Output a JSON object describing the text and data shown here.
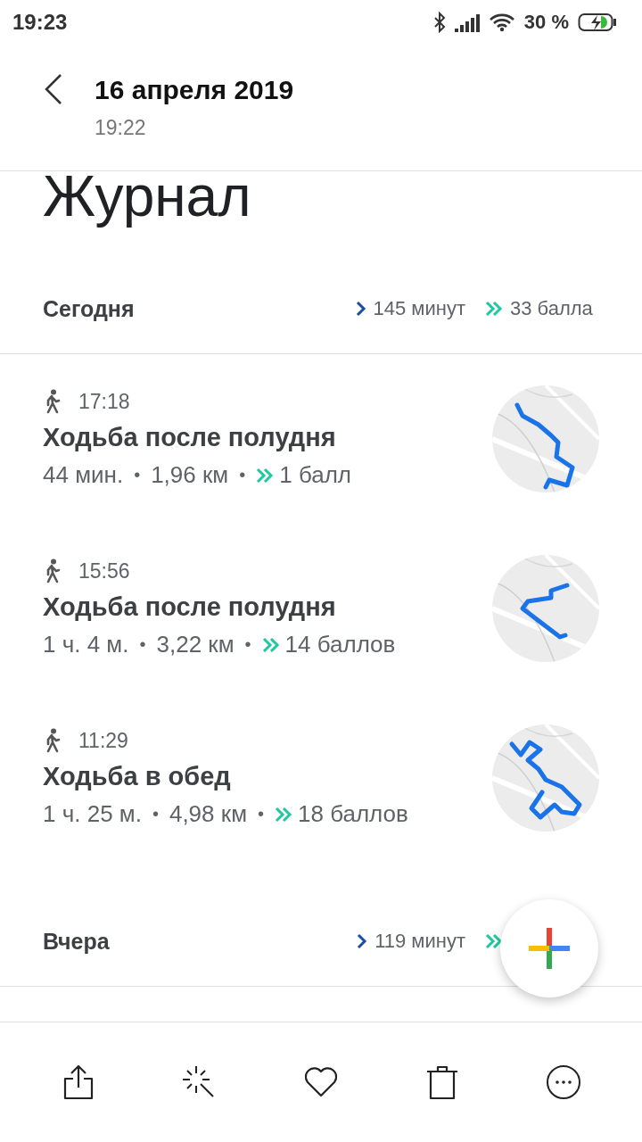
{
  "status_bar": {
    "time": "19:23",
    "battery": "30 %"
  },
  "header": {
    "title": "16 апреля 2019",
    "subtitle": "19:22"
  },
  "page_title": "Журнал",
  "sections": [
    {
      "label": "Сегодня",
      "minutes": "145 минут",
      "points": "33 балла",
      "activities": [
        {
          "time": "17:18",
          "title": "Ходьба после полудня",
          "duration": "44 мин.",
          "distance": "1,96 км",
          "separators": [
            "•",
            "•"
          ],
          "points": "1 балл"
        },
        {
          "time": "15:56",
          "title": "Ходьба после полудня",
          "duration": "1 ч. 4 м.",
          "distance": "3,22 км",
          "separators": [
            "•",
            "•"
          ],
          "points": "14 баллов"
        },
        {
          "time": "11:29",
          "title": "Ходьба в обед",
          "duration": "1 ч. 25 м.",
          "distance": "4,98 км",
          "separators": [
            "•",
            "•"
          ],
          "points": "18 баллов"
        }
      ]
    },
    {
      "label": "Вчера",
      "minutes": "119 минут"
    }
  ]
}
